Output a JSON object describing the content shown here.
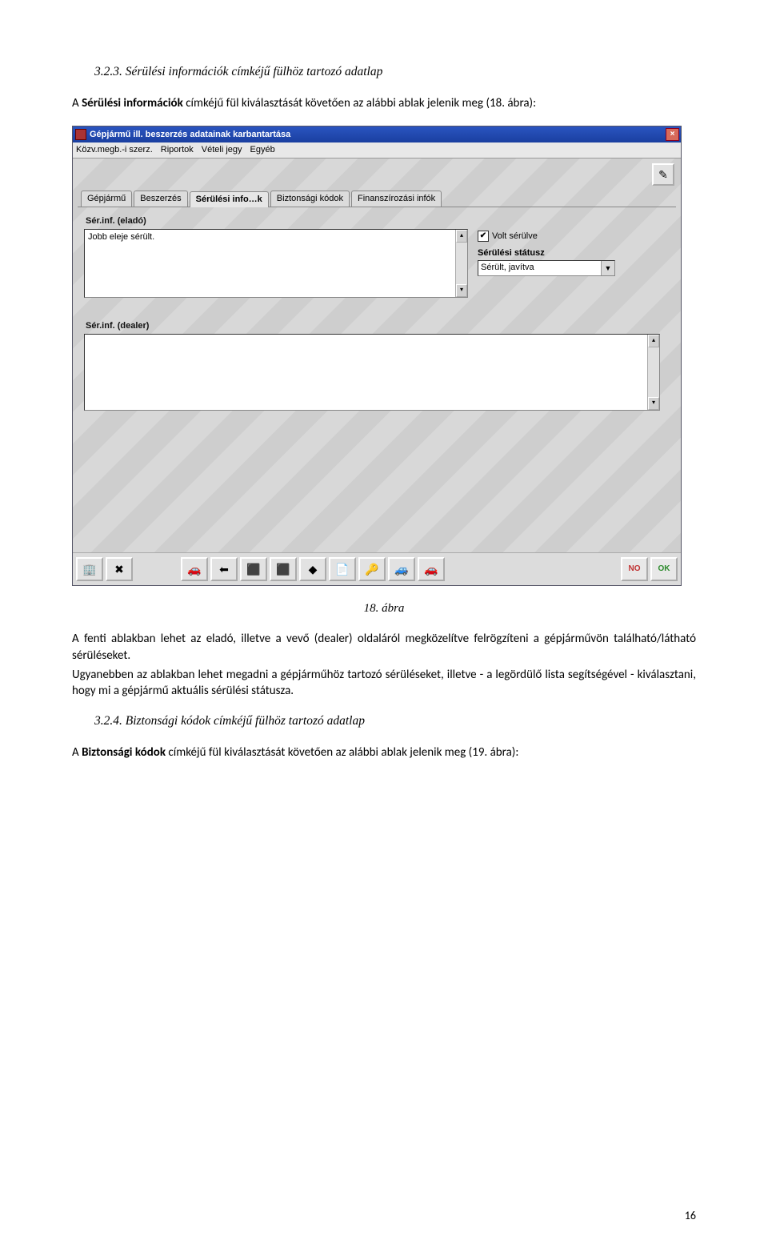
{
  "doc": {
    "heading1_num": "3.2.3.",
    "heading1_text": "Sérülési információk címkéjű fülhöz tartozó adatlap",
    "intro1_pre": "A ",
    "intro1_bold": "Sérülési információk",
    "intro1_post": " címkéjű fül kiválasztását követően az alábbi ablak jelenik meg (18. ábra):",
    "figcap": "18. ábra",
    "body1": "A fenti ablakban lehet az eladó, illetve a vevő (dealer) oldaláról megközelítve felrögzíteni a gépjárművön található/látható sérüléseket.",
    "body2": "Ugyanebben az ablakban lehet megadni a gépjárműhöz tartozó sérüléseket, illetve - a legördülő lista segítségével - kiválasztani, hogy mi a gépjármű aktuális sérülési státusza.",
    "heading2_num": "3.2.4.",
    "heading2_text": "Biztonsági kódok címkéjű fülhöz tartozó adatlap",
    "intro2_pre": "A ",
    "intro2_bold": "Biztonsági kódok",
    "intro2_post": " címkéjű fül kiválasztását követően az alábbi ablak jelenik meg (19. ábra):",
    "pagenum": "16"
  },
  "win": {
    "title": "Gépjármű ill. beszerzés adatainak karbantartása",
    "menu": [
      "Közv.megb.-i szerz.",
      "Riportok",
      "Vételi jegy",
      "Egyéb"
    ],
    "tabs": [
      "Gépjármű",
      "Beszerzés",
      "Sérülési info…k",
      "Biztonsági kódok",
      "Finanszírozási infók"
    ],
    "active_tab_index": 2,
    "section1_label": "Sér.inf. (eladó)",
    "section1_text": "Jobb eleje sérült.",
    "volt_serulve_label": "Volt sérülve",
    "volt_serulve_checked": true,
    "status_label": "Sérülési státusz",
    "status_value": "Sérült, javítva",
    "section2_label": "Sér.inf. (dealer)",
    "section2_text": "",
    "pencil_glyph": "✎",
    "toolbar_glyphs": [
      "🏢",
      "✖",
      "",
      "",
      "🚗",
      "⬅",
      "⬛",
      "⬛",
      "◆",
      "📄",
      "🔑",
      "🚙",
      "🚗"
    ],
    "no_label": "NO",
    "ok_label": "OK"
  }
}
